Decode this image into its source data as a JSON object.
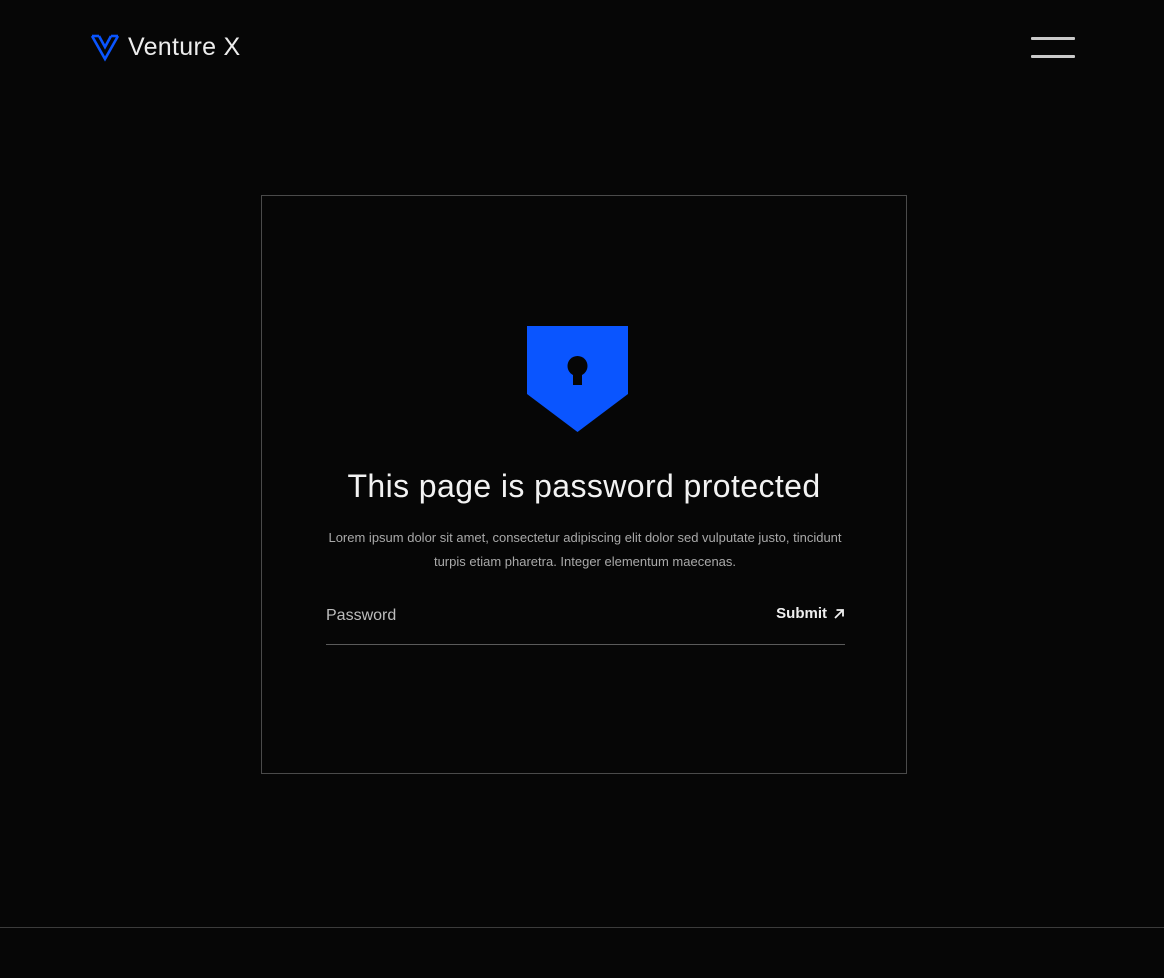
{
  "header": {
    "brand_name": "Venture X",
    "logo_icon": "venture-x-logo-icon",
    "menu_icon": "hamburger-menu-icon"
  },
  "lock_card": {
    "icon": "shield-lock-icon",
    "title": "This page is password protected",
    "description": "Lorem ipsum dolor sit amet, consectetur adipiscing elit dolor sed vulputate justo, tincidunt turpis etiam pharetra. Integer elementum maecenas.",
    "password_placeholder": "Password",
    "password_value": "",
    "submit_label": "Submit",
    "submit_icon": "arrow-up-right-icon"
  },
  "colors": {
    "background": "#060606",
    "accent": "#0a55ff",
    "text": "#f2f2f2",
    "muted_text": "#a9a9a9",
    "border": "#4a4a4a"
  }
}
